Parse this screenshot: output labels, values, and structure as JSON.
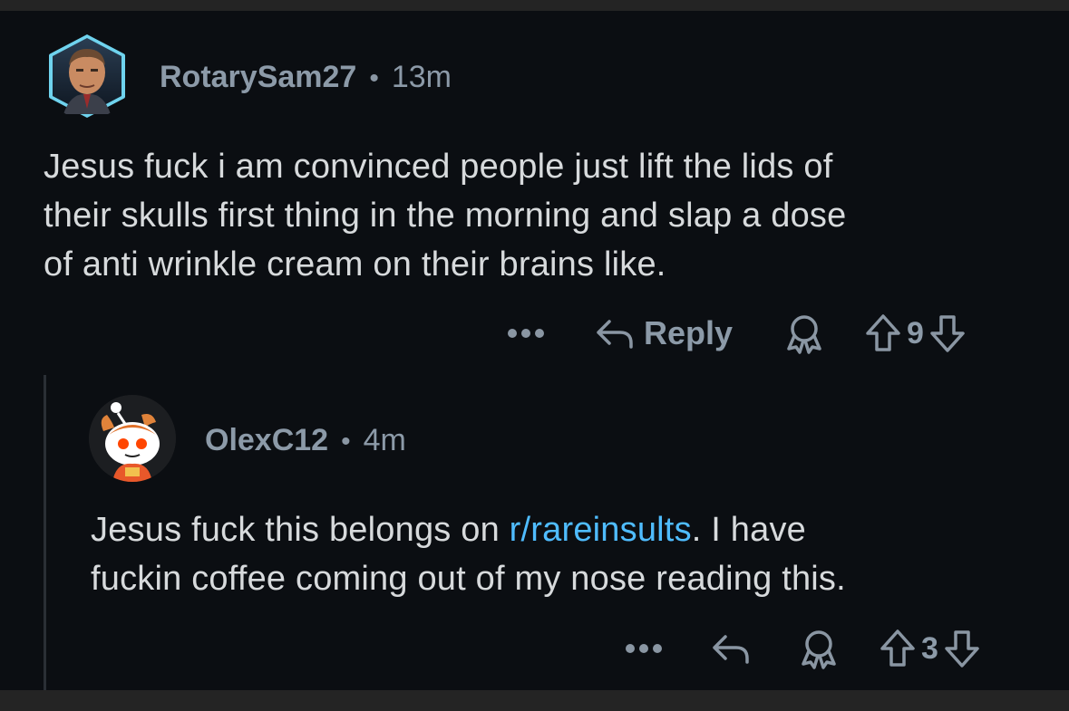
{
  "comments": [
    {
      "username": "RotarySam27",
      "separator": "•",
      "time": "13m",
      "body_lines": [
        "Jesus fuck i am convinced people just lift the lids of",
        "their skulls first thing in the morning and slap a dose",
        "of anti wrinkle cream on their brains like."
      ],
      "actions": {
        "more": "•••",
        "reply_label": "Reply",
        "vote_count": "9"
      },
      "icons": [
        "more-icon",
        "reply-icon",
        "award-icon",
        "upvote-icon",
        "downvote-icon"
      ]
    },
    {
      "username": "OlexC12",
      "separator": "•",
      "time": "4m",
      "body_prefix": "Jesus fuck this belongs on ",
      "body_link": "r/rareinsults",
      "body_suffix": ". I have",
      "body_line2": "fuckin coffee coming out of my nose reading this.",
      "actions": {
        "more": "•••",
        "vote_count": "3"
      },
      "icons": [
        "more-icon",
        "reply-icon",
        "award-icon",
        "upvote-icon",
        "downvote-icon"
      ]
    }
  ],
  "colors": {
    "background": "#0b0e12",
    "text": "#d7dadc",
    "meta": "#8c9aa8",
    "link": "#4fbcff"
  }
}
